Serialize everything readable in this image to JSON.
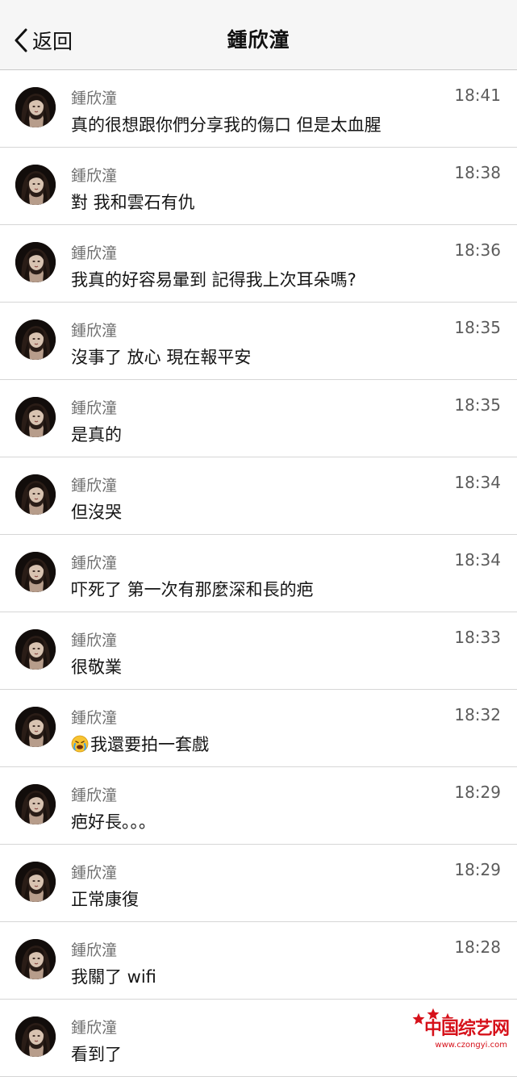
{
  "nav": {
    "back_label": "返回",
    "title": "鍾欣潼"
  },
  "messages": [
    {
      "sender": "鍾欣潼",
      "time": "18:41",
      "text": "真的很想跟你們分享我的傷口 但是太血腥"
    },
    {
      "sender": "鍾欣潼",
      "time": "18:38",
      "text": "對 我和雲石有仇"
    },
    {
      "sender": "鍾欣潼",
      "time": "18:36",
      "text": "我真的好容易暈到 記得我上次耳朵嗎?"
    },
    {
      "sender": "鍾欣潼",
      "time": "18:35",
      "text": "沒事了 放心 現在報平安"
    },
    {
      "sender": "鍾欣潼",
      "time": "18:35",
      "text": "是真的"
    },
    {
      "sender": "鍾欣潼",
      "time": "18:34",
      "text": "但沒哭"
    },
    {
      "sender": "鍾欣潼",
      "time": "18:34",
      "text": "吓死了 第一次有那麼深和長的疤"
    },
    {
      "sender": "鍾欣潼",
      "time": "18:33",
      "text": "很敬業"
    },
    {
      "sender": "鍾欣潼",
      "time": "18:32",
      "text": "我還要拍一套戲",
      "emoji": "crying-emoji"
    },
    {
      "sender": "鍾欣潼",
      "time": "18:29",
      "text": "疤好長。。。"
    },
    {
      "sender": "鍾欣潼",
      "time": "18:29",
      "text": "正常康復"
    },
    {
      "sender": "鍾欣潼",
      "time": "18:28",
      "text": "我關了 wifi"
    },
    {
      "sender": "鍾欣潼",
      "time": "",
      "text": "看到了"
    }
  ],
  "watermark": {
    "text": "中国综艺网",
    "url": "www.czongyi.com",
    "color": "#d6111a"
  }
}
